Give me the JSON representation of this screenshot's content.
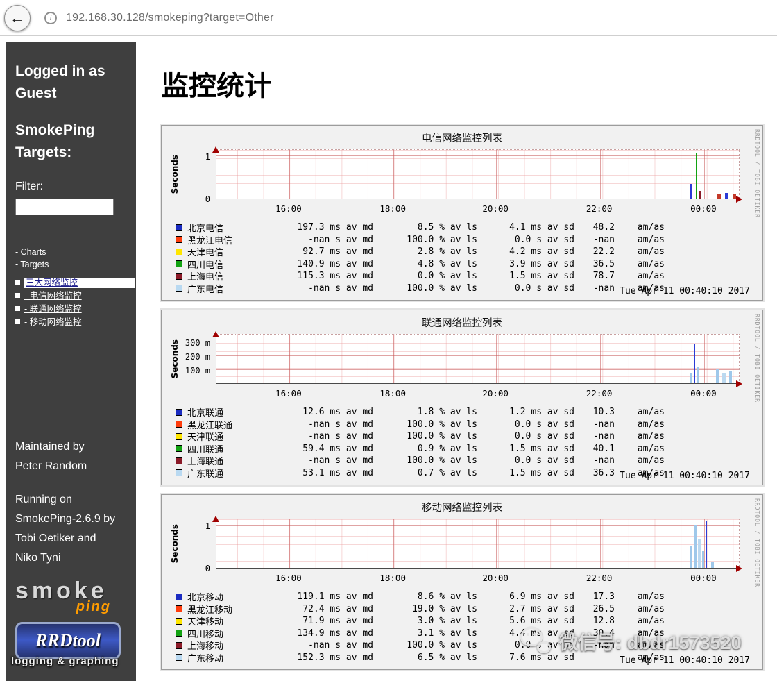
{
  "browser": {
    "url": "192.168.30.128/smokeping?target=Other",
    "back_glyph": "←",
    "info_glyph": "i"
  },
  "sidebar": {
    "logged_in": "Logged in as\nGuest",
    "targets_heading": "SmokePing\nTargets:",
    "filter_label": "Filter:",
    "filter_value": "",
    "nav_links": [
      "- Charts",
      "- Targets"
    ],
    "tree_root": "三大网络监控",
    "tree_items": [
      "- 电信网络监控",
      "- 联通网络监控",
      "- 移动网络监控"
    ],
    "maintained": "Maintained by\nPeter Random",
    "running": "Running on\nSmokePing-2.6.9 by\nTobi Oetiker and\nNiko Tyni",
    "logo_smoke": "smoke",
    "logo_ping": "ping",
    "rrdtool_logo": "RRDtool",
    "overlay_watermark": "logging & graphing"
  },
  "main": {
    "title": "监控统计",
    "wechat_watermark": "微信号: dbdr1573520"
  },
  "chart_data": [
    {
      "type": "line",
      "title": "电信网络监控列表",
      "ylabel": "Seconds",
      "ylim": [
        0,
        1.2
      ],
      "yticks": [
        {
          "label": "1",
          "frac": 0.85
        },
        {
          "label": "0",
          "frac": 0
        }
      ],
      "xticks": [
        {
          "label": "16:00",
          "frac": 0.139
        },
        {
          "label": "18:00",
          "frac": 0.338
        },
        {
          "label": "20:00",
          "frac": 0.534
        },
        {
          "label": "22:00",
          "frac": 0.732
        },
        {
          "label": "00:00",
          "frac": 0.931
        }
      ],
      "spikes": [
        {
          "x": 0.905,
          "h": 0.3,
          "c": "#2b3bd6",
          "w": 2
        },
        {
          "x": 0.915,
          "h": 0.95,
          "c": "#12a312",
          "w": 2
        },
        {
          "x": 0.922,
          "h": 0.16,
          "c": "#8b1a28",
          "w": 2
        },
        {
          "x": 0.956,
          "h": 0.1,
          "c": "#c43a2a",
          "w": 5
        },
        {
          "x": 0.971,
          "h": 0.12,
          "c": "#2b3bd6",
          "w": 5
        },
        {
          "x": 0.985,
          "h": 0.09,
          "c": "#c43a2a",
          "w": 5
        }
      ],
      "legend_rows": [
        {
          "color": "#1b2cc1",
          "label": "北京电信",
          "median": "197.3 ms av md",
          "loss": "8.5 % av ls",
          "sd": "4.1 ms av sd",
          "ratio": "48.2",
          "unit": "am/as"
        },
        {
          "color": "#ff3d0d",
          "label": "黑龙江电信",
          "median": "-nan s av md",
          "loss": "100.0 % av ls",
          "sd": "0.0 s av sd",
          "ratio": "-nan",
          "unit": "am/as"
        },
        {
          "color": "#ffe600",
          "label": "天津电信",
          "median": "92.7 ms av md",
          "loss": "2.8 % av ls",
          "sd": "4.2 ms av sd",
          "ratio": "22.2",
          "unit": "am/as"
        },
        {
          "color": "#12a312",
          "label": "四川电信",
          "median": "140.9 ms av md",
          "loss": "4.8 % av ls",
          "sd": "3.9 ms av sd",
          "ratio": "36.5",
          "unit": "am/as"
        },
        {
          "color": "#8b1a28",
          "label": "上海电信",
          "median": "115.3 ms av md",
          "loss": "0.0 % av ls",
          "sd": "1.5 ms av sd",
          "ratio": "78.7",
          "unit": "am/as"
        },
        {
          "color": "#b9d9f1",
          "label": "广东电信",
          "median": "-nan s av md",
          "loss": "100.0 % av ls",
          "sd": "0.0 s av sd",
          "ratio": "-nan",
          "unit": "am/as"
        }
      ],
      "timestamp": "Tue Apr 11 00:40:10 2017",
      "side_text": "RRDTOOL / TOBI OETIKER"
    },
    {
      "type": "line",
      "title": "联通网络监控列表",
      "ylabel": "Seconds",
      "ylim": [
        0,
        0.38
      ],
      "yticks": [
        {
          "label": "300 m",
          "frac": 0.82
        },
        {
          "label": "200 m",
          "frac": 0.54
        },
        {
          "label": "100 m",
          "frac": 0.26
        }
      ],
      "xticks": [
        {
          "label": "16:00",
          "frac": 0.139
        },
        {
          "label": "18:00",
          "frac": 0.338
        },
        {
          "label": "20:00",
          "frac": 0.534
        },
        {
          "label": "22:00",
          "frac": 0.732
        },
        {
          "label": "00:00",
          "frac": 0.931
        }
      ],
      "spikes": [
        {
          "x": 0.903,
          "h": 0.22,
          "c": "#9fc8ea",
          "w": 3
        },
        {
          "x": 0.911,
          "h": 0.8,
          "c": "#2b3bd6",
          "w": 2
        },
        {
          "x": 0.917,
          "h": 0.35,
          "c": "#9fc8ea",
          "w": 3
        },
        {
          "x": 0.953,
          "h": 0.3,
          "c": "#9fc8ea",
          "w": 4
        },
        {
          "x": 0.966,
          "h": 0.22,
          "c": "#bcd9f0",
          "w": 6
        },
        {
          "x": 0.979,
          "h": 0.26,
          "c": "#9fc8ea",
          "w": 4
        }
      ],
      "legend_rows": [
        {
          "color": "#1b2cc1",
          "label": "北京联通",
          "median": "12.6 ms av md",
          "loss": "1.8 % av ls",
          "sd": "1.2 ms av sd",
          "ratio": "10.3",
          "unit": "am/as"
        },
        {
          "color": "#ff3d0d",
          "label": "黑龙江联通",
          "median": "-nan s av md",
          "loss": "100.0 % av ls",
          "sd": "0.0 s av sd",
          "ratio": "-nan",
          "unit": "am/as"
        },
        {
          "color": "#ffe600",
          "label": "天津联通",
          "median": "-nan s av md",
          "loss": "100.0 % av ls",
          "sd": "0.0 s av sd",
          "ratio": "-nan",
          "unit": "am/as"
        },
        {
          "color": "#12a312",
          "label": "四川联通",
          "median": "59.4 ms av md",
          "loss": "0.9 % av ls",
          "sd": "1.5 ms av sd",
          "ratio": "40.1",
          "unit": "am/as"
        },
        {
          "color": "#8b1a28",
          "label": "上海联通",
          "median": "-nan s av md",
          "loss": "100.0 % av ls",
          "sd": "0.0 s av sd",
          "ratio": "-nan",
          "unit": "am/as"
        },
        {
          "color": "#b9d9f1",
          "label": "广东联通",
          "median": "53.1 ms av md",
          "loss": "0.7 % av ls",
          "sd": "1.5 ms av sd",
          "ratio": "36.3",
          "unit": "am/as"
        }
      ],
      "timestamp": "Tue Apr 11 00:40:10 2017",
      "side_text": "RRDTOOL / TOBI OETIKER"
    },
    {
      "type": "line",
      "title": "移动网络监控列表",
      "ylabel": "Seconds",
      "ylim": [
        0,
        1.2
      ],
      "yticks": [
        {
          "label": "1",
          "frac": 0.85
        },
        {
          "label": "0",
          "frac": 0
        }
      ],
      "xticks": [
        {
          "label": "16:00",
          "frac": 0.139
        },
        {
          "label": "18:00",
          "frac": 0.338
        },
        {
          "label": "20:00",
          "frac": 0.534
        },
        {
          "label": "22:00",
          "frac": 0.732
        },
        {
          "label": "00:00",
          "frac": 0.931
        }
      ],
      "spikes": [
        {
          "x": 0.903,
          "h": 0.45,
          "c": "#9fc8ea",
          "w": 3
        },
        {
          "x": 0.911,
          "h": 0.88,
          "c": "#9fc8ea",
          "w": 4
        },
        {
          "x": 0.919,
          "h": 0.6,
          "c": "#bcd9f0",
          "w": 4
        },
        {
          "x": 0.927,
          "h": 0.35,
          "c": "#9fc8ea",
          "w": 3
        },
        {
          "x": 0.934,
          "h": 0.97,
          "c": "#2b3bd6",
          "w": 2
        },
        {
          "x": 0.945,
          "h": 0.12,
          "c": "#9fc8ea",
          "w": 4
        }
      ],
      "legend_rows": [
        {
          "color": "#1b2cc1",
          "label": "北京移动",
          "median": "119.1 ms av md",
          "loss": "8.6 % av ls",
          "sd": "6.9 ms av sd",
          "ratio": "17.3",
          "unit": "am/as"
        },
        {
          "color": "#ff3d0d",
          "label": "黑龙江移动",
          "median": "72.4 ms av md",
          "loss": "19.0 % av ls",
          "sd": "2.7 ms av sd",
          "ratio": "26.5",
          "unit": "am/as"
        },
        {
          "color": "#ffe600",
          "label": "天津移动",
          "median": "71.9 ms av md",
          "loss": "3.0 % av ls",
          "sd": "5.6 ms av sd",
          "ratio": "12.8",
          "unit": "am/as"
        },
        {
          "color": "#12a312",
          "label": "四川移动",
          "median": "134.9 ms av md",
          "loss": "3.1 % av ls",
          "sd": "4.4 ms av sd",
          "ratio": "30.4",
          "unit": "am/as"
        },
        {
          "color": "#8b1a28",
          "label": "上海移动",
          "median": "-nan s av md",
          "loss": "100.0 % av ls",
          "sd": "0.0 s av sd",
          "ratio": "-nan",
          "unit": "am/as"
        },
        {
          "color": "#b9d9f1",
          "label": "广东移动",
          "median": "152.3 ms av md",
          "loss": "6.5 % av ls",
          "sd": "7.6 ms av sd",
          "ratio": "",
          "unit": "am/as"
        }
      ],
      "timestamp": "Tue Apr 11 00:40:10 2017",
      "side_text": "RRDTOOL / TOBI OETIKER"
    }
  ]
}
